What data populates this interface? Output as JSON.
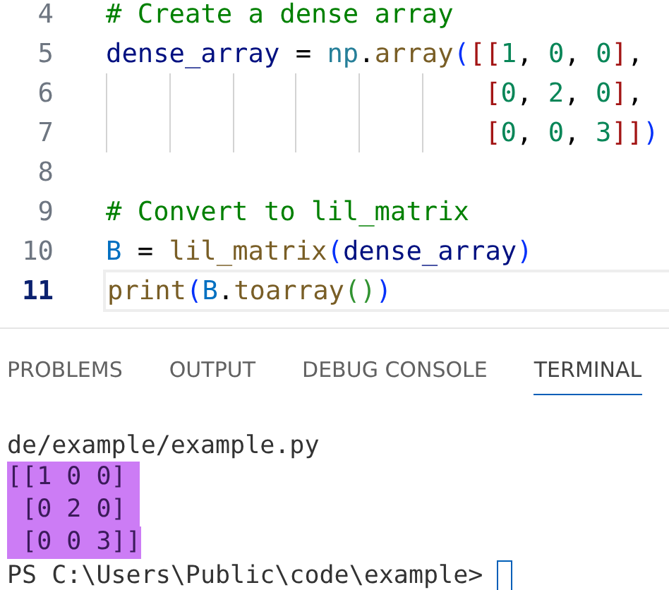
{
  "editor": {
    "lines": [
      {
        "number": "4",
        "current": false,
        "tokens": [
          {
            "text": "# Create a dense array",
            "kind": "comment"
          }
        ]
      },
      {
        "number": "5",
        "current": false,
        "tokens": [
          {
            "text": "dense_array",
            "kind": "var"
          },
          {
            "text": " = ",
            "kind": "plain"
          },
          {
            "text": "np",
            "kind": "module"
          },
          {
            "text": ".",
            "kind": "plain"
          },
          {
            "text": "array",
            "kind": "func"
          },
          {
            "text": "(",
            "kind": "paren"
          },
          {
            "text": "[[",
            "kind": "bracket"
          },
          {
            "text": "1",
            "kind": "num"
          },
          {
            "text": ", ",
            "kind": "plain"
          },
          {
            "text": "0",
            "kind": "num"
          },
          {
            "text": ", ",
            "kind": "plain"
          },
          {
            "text": "0",
            "kind": "num"
          },
          {
            "text": "]",
            "kind": "bracket"
          },
          {
            "text": ",",
            "kind": "plain"
          }
        ]
      },
      {
        "number": "6",
        "current": false,
        "tokens": [
          {
            "text": "                        [",
            "kind": "bracket"
          },
          {
            "text": "0",
            "kind": "num"
          },
          {
            "text": ", ",
            "kind": "plain"
          },
          {
            "text": "2",
            "kind": "num"
          },
          {
            "text": ", ",
            "kind": "plain"
          },
          {
            "text": "0",
            "kind": "num"
          },
          {
            "text": "]",
            "kind": "bracket"
          },
          {
            "text": ",",
            "kind": "plain"
          }
        ]
      },
      {
        "number": "7",
        "current": false,
        "tokens": [
          {
            "text": "                        [",
            "kind": "bracket"
          },
          {
            "text": "0",
            "kind": "num"
          },
          {
            "text": ", ",
            "kind": "plain"
          },
          {
            "text": "0",
            "kind": "num"
          },
          {
            "text": ", ",
            "kind": "plain"
          },
          {
            "text": "3",
            "kind": "num"
          },
          {
            "text": "]]",
            "kind": "bracket"
          },
          {
            "text": ")",
            "kind": "paren"
          }
        ]
      },
      {
        "number": "8",
        "current": false
      },
      {
        "number": "9",
        "current": false,
        "tokens": [
          {
            "text": "# Convert to lil_matrix",
            "kind": "comment"
          }
        ]
      },
      {
        "number": "10",
        "current": false,
        "tokens": [
          {
            "text": "B",
            "kind": "const"
          },
          {
            "text": " = ",
            "kind": "plain"
          },
          {
            "text": "lil_matrix",
            "kind": "func"
          },
          {
            "text": "(",
            "kind": "paren"
          },
          {
            "text": "dense_array",
            "kind": "var"
          },
          {
            "text": ")",
            "kind": "paren"
          }
        ]
      },
      {
        "number": "11",
        "current": true,
        "tokens": [
          {
            "text": "print",
            "kind": "func"
          },
          {
            "text": "(",
            "kind": "paren"
          },
          {
            "text": "B",
            "kind": "const"
          },
          {
            "text": ".",
            "kind": "plain"
          },
          {
            "text": "toarray",
            "kind": "func"
          },
          {
            "text": "()",
            "kind": "paren2"
          },
          {
            "text": ")",
            "kind": "paren"
          }
        ]
      }
    ]
  },
  "panel": {
    "tabs": [
      {
        "label": "PROBLEMS",
        "selected": false
      },
      {
        "label": "OUTPUT",
        "selected": false
      },
      {
        "label": "DEBUG CONSOLE",
        "selected": false
      },
      {
        "label": "TERMINAL",
        "selected": true
      }
    ],
    "terminal": [
      {
        "text": "de/example/example.py",
        "selected": false
      },
      {
        "text": "[[1 0 0]",
        "selected": true
      },
      {
        "text": " [0 2 0]",
        "selected": true
      },
      {
        "text": " [0 0 3]]",
        "selected": true
      },
      {
        "text": "PS C:\\Users\\Public\\code\\example>",
        "selected": false,
        "kind": "prompt"
      }
    ]
  }
}
